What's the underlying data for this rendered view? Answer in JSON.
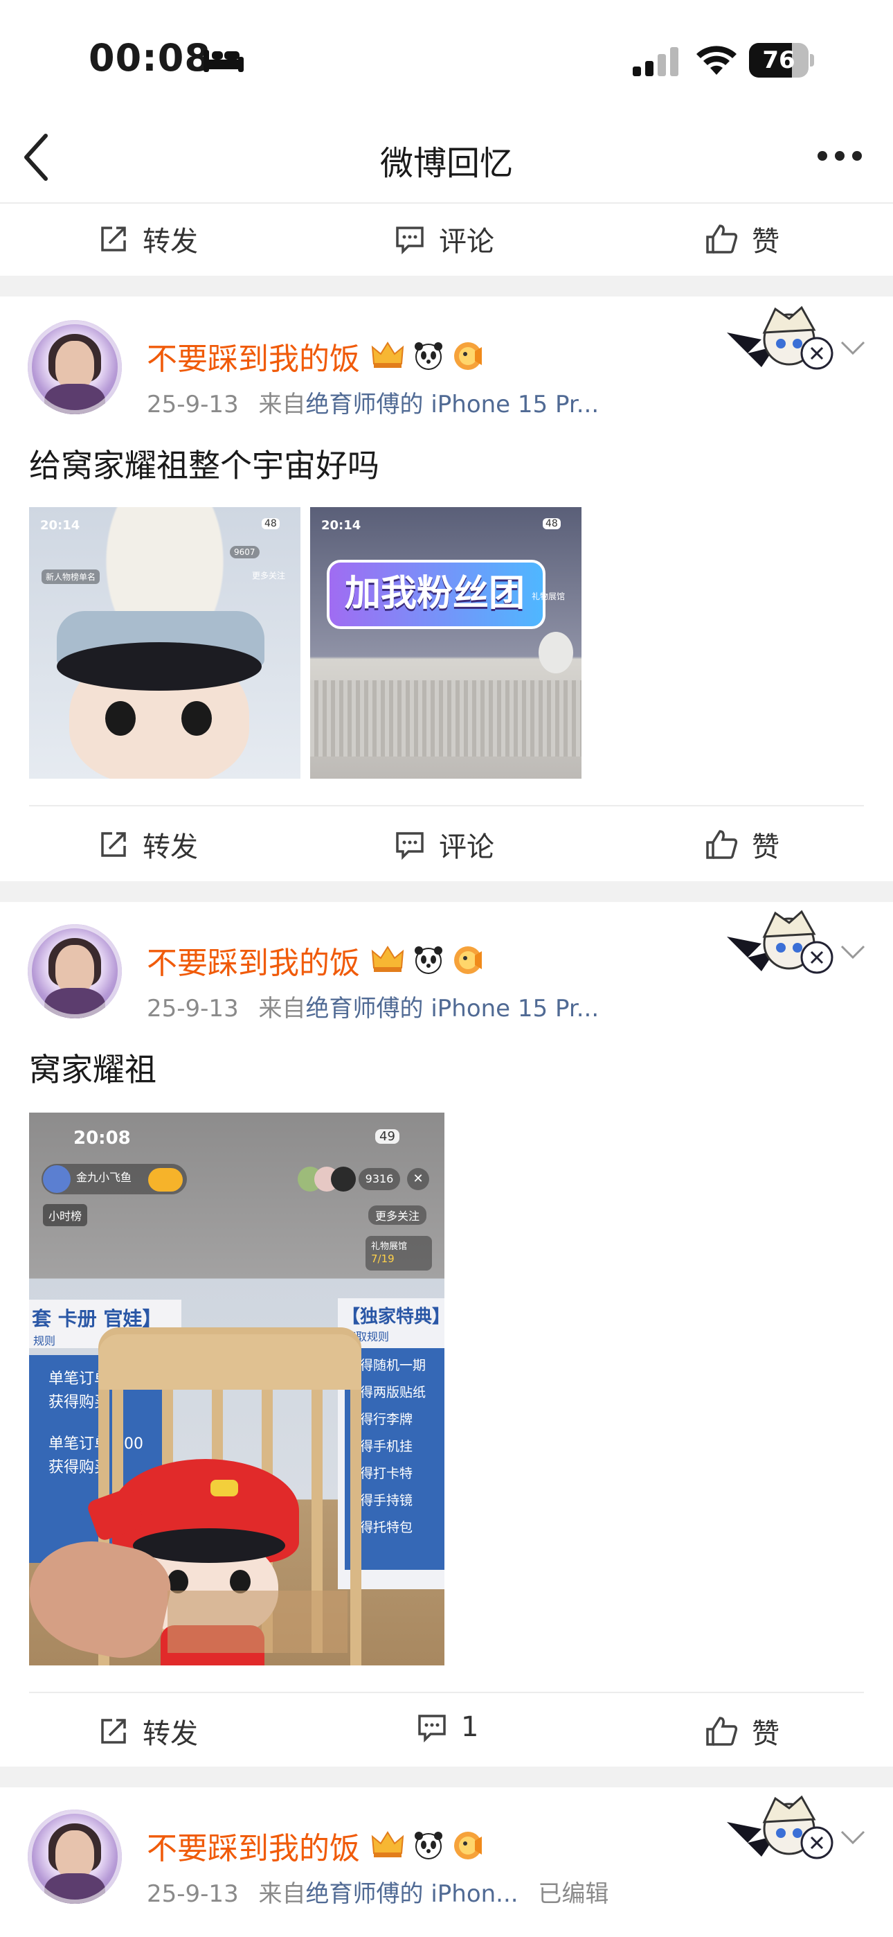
{
  "status_bar": {
    "time": "00:08",
    "battery": "76"
  },
  "nav": {
    "title": "微博回忆"
  },
  "actions": {
    "repost": "转发",
    "comment": "评论",
    "like": "赞"
  },
  "posts": [
    {
      "username": "不要踩到我的饭",
      "date": "25-9-13",
      "from_label": "来自",
      "source": "绝育师傅的 iPhone 15 Pr...",
      "edited": "",
      "text": "给窝家耀祖整个宇宙好吗",
      "image1": {
        "time": "20:14",
        "battery": "48",
        "count": "9607",
        "row1": "新人物榜单名",
        "row2": "更多关注"
      },
      "image2": {
        "time": "20:14",
        "battery": "48",
        "banner": "加我粉丝团",
        "sub": "礼物展馆"
      },
      "comment_count": ""
    },
    {
      "username": "不要踩到我的饭",
      "date": "25-9-13",
      "from_label": "来自",
      "source": "绝育师傅的 iPhone 15 Pr...",
      "edited": "",
      "text": "窝家耀祖",
      "image": {
        "time": "20:08",
        "battery": "49",
        "host": "金九小飞鱼",
        "viewers": "9316",
        "rank": "小时榜",
        "follow": "更多关注",
        "gift_label": "礼物展馆",
        "gift_count": "7/19",
        "left_title": "套 卡册 官娃】",
        "right_title": "【独家特典】",
        "left_sub": "规则",
        "right_sub": "获取规则",
        "left_rows": [
          "单笔订单",
          "获得购买",
          "单笔订单 300",
          "获得购买"
        ],
        "right_rows": [
          "得随机一期",
          "得两版贴纸",
          "得行李牌",
          "得手机挂",
          "得打卡特",
          "得手持镜",
          "得托特包"
        ]
      },
      "comment_count": "1"
    },
    {
      "username": "不要踩到我的饭",
      "date": "25-9-13",
      "from_label": "来自",
      "source": "绝育师傅的 iPhon...",
      "edited": "已编辑",
      "text": "",
      "comment_count": ""
    }
  ],
  "colors": {
    "username": "#f05b0a",
    "source": "#506a94",
    "meta": "#8a8a8a",
    "band": "#f1f1f1"
  }
}
